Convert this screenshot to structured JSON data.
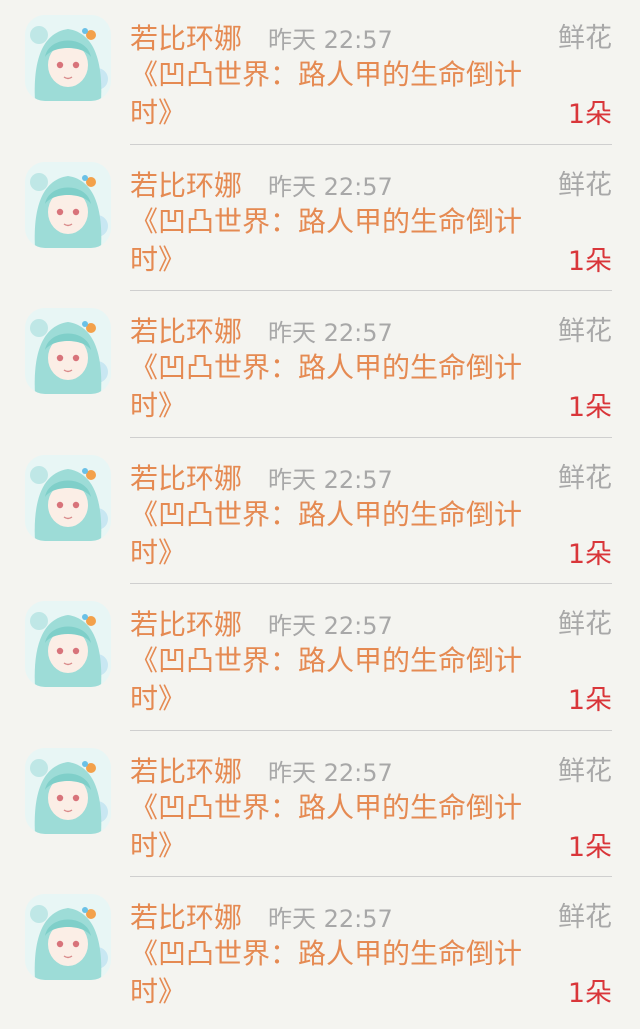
{
  "colors": {
    "background": "#f4f4f0",
    "accent_orange": "#e58a52",
    "muted_gray": "#a8a8a8",
    "count_red": "#d9363a",
    "divider": "#cfcfcf"
  },
  "items": [
    {
      "avatar_icon": "user-avatar-anime-girl",
      "name": "若比环娜",
      "time": "昨天 22:57",
      "gift_type": "鲜花",
      "book_title": "《凹凸世界：路人甲的生命倒计时》",
      "count": "1朵"
    },
    {
      "avatar_icon": "user-avatar-anime-girl",
      "name": "若比环娜",
      "time": "昨天 22:57",
      "gift_type": "鲜花",
      "book_title": "《凹凸世界：路人甲的生命倒计时》",
      "count": "1朵"
    },
    {
      "avatar_icon": "user-avatar-anime-girl",
      "name": "若比环娜",
      "time": "昨天 22:57",
      "gift_type": "鲜花",
      "book_title": "《凹凸世界：路人甲的生命倒计时》",
      "count": "1朵"
    },
    {
      "avatar_icon": "user-avatar-anime-girl",
      "name": "若比环娜",
      "time": "昨天 22:57",
      "gift_type": "鲜花",
      "book_title": "《凹凸世界：路人甲的生命倒计时》",
      "count": "1朵"
    },
    {
      "avatar_icon": "user-avatar-anime-girl",
      "name": "若比环娜",
      "time": "昨天 22:57",
      "gift_type": "鲜花",
      "book_title": "《凹凸世界：路人甲的生命倒计时》",
      "count": "1朵"
    },
    {
      "avatar_icon": "user-avatar-anime-girl",
      "name": "若比环娜",
      "time": "昨天 22:57",
      "gift_type": "鲜花",
      "book_title": "《凹凸世界：路人甲的生命倒计时》",
      "count": "1朵"
    },
    {
      "avatar_icon": "user-avatar-anime-girl",
      "name": "若比环娜",
      "time": "昨天 22:57",
      "gift_type": "鲜花",
      "book_title": "《凹凸世界：路人甲的生命倒计时》",
      "count": "1朵"
    }
  ]
}
